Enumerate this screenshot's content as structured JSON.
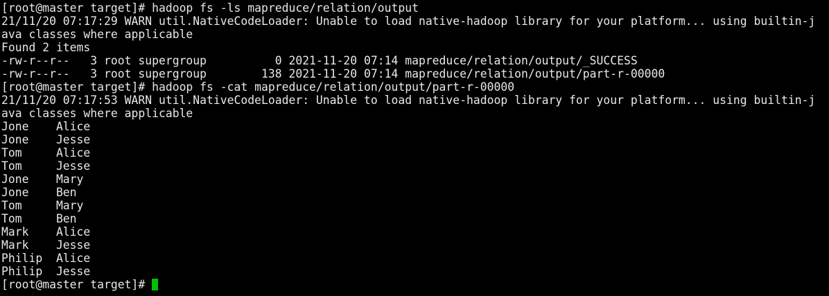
{
  "terminal": {
    "cursor_color": "#00c000",
    "text_color": "#e8e8e8",
    "background": "#000000",
    "lines": [
      "[root@master target]# hadoop fs -ls mapreduce/relation/output",
      "21/11/20 07:17:29 WARN util.NativeCodeLoader: Unable to load native-hadoop library for your platform... using builtin-j",
      "ava classes where applicable",
      "Found 2 items",
      "-rw-r--r--   3 root supergroup          0 2021-11-20 07:14 mapreduce/relation/output/_SUCCESS",
      "-rw-r--r--   3 root supergroup        138 2021-11-20 07:14 mapreduce/relation/output/part-r-00000",
      "[root@master target]# hadoop fs -cat mapreduce/relation/output/part-r-00000",
      "21/11/20 07:17:53 WARN util.NativeCodeLoader: Unable to load native-hadoop library for your platform... using builtin-j",
      "ava classes where applicable",
      "Jone    Alice",
      "Jone    Jesse",
      "Tom     Alice",
      "Tom     Jesse",
      "Jone    Mary",
      "Jone    Ben",
      "Tom     Mary",
      "Tom     Ben",
      "Mark    Alice",
      "Mark    Jesse",
      "Philip  Alice",
      "Philip  Jesse"
    ],
    "prompt": "[root@master target]#"
  }
}
